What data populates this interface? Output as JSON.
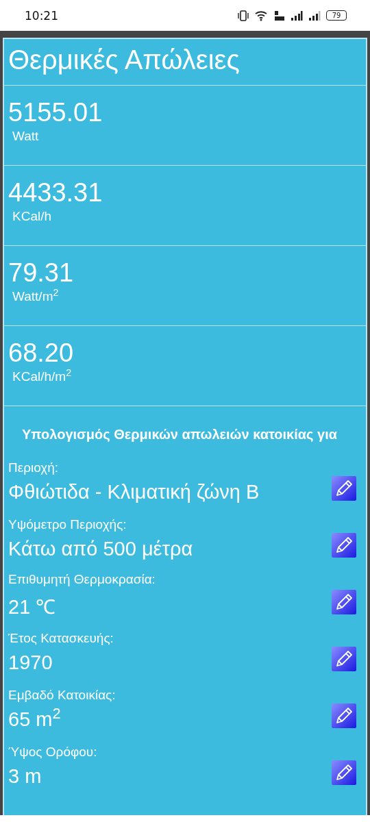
{
  "status_bar": {
    "time": "10:21",
    "battery": "79"
  },
  "title": "Θερμικές Απώλειες",
  "results": [
    {
      "value": "5155.01",
      "unit": "Watt"
    },
    {
      "value": "4433.31",
      "unit": "KCal/h"
    },
    {
      "value": "79.31",
      "unit": "Watt/m$^{2}$"
    },
    {
      "value": "68.20",
      "unit": "KCal/h/m$^{2}$"
    }
  ],
  "section_heading": "Υπολογισμός Θερμικών απωλειών κατοικίας για",
  "fields": [
    {
      "label": "Περιοχή:",
      "value": "Φθιώτιδα - Κλιματική ζώνη Β"
    },
    {
      "label": "Υψόμετρο Περιοχής:",
      "value": "Κάτω από 500 μέτρα"
    },
    {
      "label": "Επιθυμητή Θερμοκρασία:",
      "value": "21 ℃"
    },
    {
      "label": "Έτος Κατασκευής:",
      "value": "1970"
    },
    {
      "label": "Εμβαδό Κατοικίας:",
      "value": "65 m$^{2}$"
    },
    {
      "label": "Ύψος Ορόφου:",
      "value": "3 m"
    }
  ]
}
